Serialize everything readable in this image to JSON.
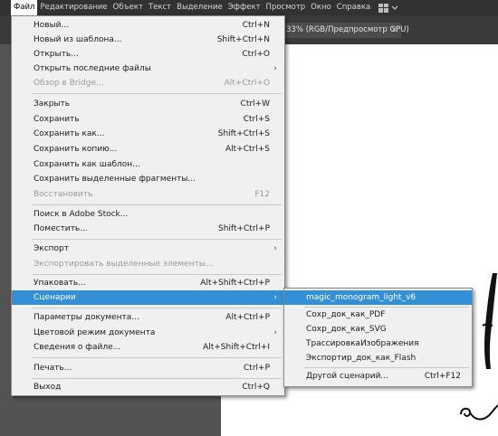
{
  "menubar": {
    "items": [
      "Файл",
      "Редактирование",
      "Объект",
      "Текст",
      "Выделение",
      "Эффект",
      "Просмотр",
      "Окно",
      "Справка"
    ]
  },
  "document_tab": {
    "title": "33% (RGB/Предпросмотр GPU)",
    "close": "×"
  },
  "file_menu": {
    "items": [
      {
        "label": "Новый...",
        "shortcut": "Ctrl+N"
      },
      {
        "label": "Новый из шаблона...",
        "shortcut": "Shift+Ctrl+N"
      },
      {
        "label": "Открыть...",
        "shortcut": "Ctrl+O"
      },
      {
        "label": "Открыть последние файлы",
        "shortcut": ""
      },
      {
        "label": "Обзор в Bridge...",
        "shortcut": "Alt+Ctrl+O"
      },
      {
        "label": "Закрыть",
        "shortcut": "Ctrl+W"
      },
      {
        "label": "Сохранить",
        "shortcut": "Ctrl+S"
      },
      {
        "label": "Сохранить как...",
        "shortcut": "Shift+Ctrl+S"
      },
      {
        "label": "Сохранить копию...",
        "shortcut": "Alt+Ctrl+S"
      },
      {
        "label": "Сохранить как шаблон...",
        "shortcut": ""
      },
      {
        "label": "Сохранить выделенные фрагменты...",
        "shortcut": ""
      },
      {
        "label": "Восстановить",
        "shortcut": "F12"
      },
      {
        "label": "Поиск в Adobe Stock...",
        "shortcut": ""
      },
      {
        "label": "Поместить...",
        "shortcut": "Shift+Ctrl+P"
      },
      {
        "label": "Экспорт",
        "shortcut": ""
      },
      {
        "label": "Экспортировать выделенные элементы...",
        "shortcut": ""
      },
      {
        "label": "Упаковать...",
        "shortcut": "Alt+Shift+Ctrl+P"
      },
      {
        "label": "Сценарии",
        "shortcut": ""
      },
      {
        "label": "Параметры документа...",
        "shortcut": "Alt+Ctrl+P"
      },
      {
        "label": "Цветовой режим документа",
        "shortcut": ""
      },
      {
        "label": "Сведения о файле...",
        "shortcut": "Alt+Shift+Ctrl+I"
      },
      {
        "label": "Печать...",
        "shortcut": "Ctrl+P"
      },
      {
        "label": "Выход",
        "shortcut": "Ctrl+Q"
      }
    ],
    "submenu_arrow": "›"
  },
  "scripts_submenu": {
    "items": [
      {
        "label": "magic_monogram_light_v6",
        "shortcut": ""
      },
      {
        "label": "Сохр_док_как_PDF",
        "shortcut": ""
      },
      {
        "label": "Сохр_док_как_SVG",
        "shortcut": ""
      },
      {
        "label": "ТрассировкаИзображения",
        "shortcut": ""
      },
      {
        "label": "Экспортир_док_как_Flash",
        "shortcut": ""
      },
      {
        "label": "Другой сценарий...",
        "shortcut": "Ctrl+F12"
      }
    ]
  },
  "colors": {
    "highlight": "#3390d6",
    "menubar": "#323232",
    "workspace": "#535353"
  }
}
